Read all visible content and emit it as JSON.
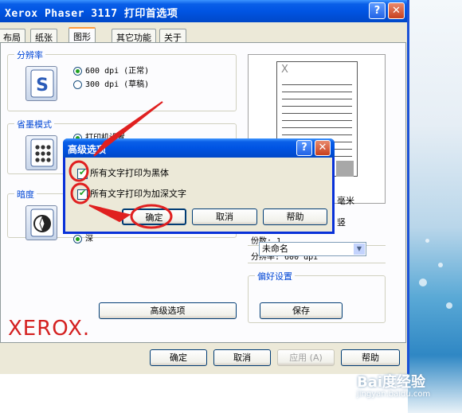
{
  "window": {
    "title": "Xerox Phaser 3117 打印首选项",
    "help_btn": "?",
    "close_btn": "✕"
  },
  "tabs": [
    {
      "label": "布局"
    },
    {
      "label": "纸张"
    },
    {
      "label": "图形"
    },
    {
      "label": "其它功能"
    },
    {
      "label": "关于"
    }
  ],
  "resolution": {
    "label": "分辨率",
    "options": [
      "600 dpi (正常)",
      "300 dpi (草稿)"
    ],
    "selected": 0
  },
  "toner_save": {
    "label": "省墨模式",
    "partial_option": "打印机设置"
  },
  "darkness": {
    "label": "暗度",
    "partial_option": "深"
  },
  "advanced_button": "高级选项",
  "preview": {
    "page_letter": "X",
    "unit_fragment": "毫米",
    "orientation_fragment": "竖",
    "copies": "份数: 1",
    "resolution": "分辨率: 600 dpi"
  },
  "favorites": {
    "label": "偏好设置",
    "selected": "未命名",
    "save_button": "保存"
  },
  "brand": "XEROX.",
  "bottom_buttons": {
    "ok": "确定",
    "cancel": "取消",
    "apply": "应用 (A)",
    "help": "帮助"
  },
  "dialog": {
    "title": "高级选项",
    "checkboxes": [
      {
        "label": "所有文字打印为黑体",
        "checked": true
      },
      {
        "label": "所有文字打印为加深文字",
        "checked": true
      }
    ],
    "ok": "确定",
    "cancel": "取消",
    "help": "帮助"
  },
  "watermark": {
    "text": "Bai度经验",
    "sub": "jingyan.baidu.com"
  },
  "colors": {
    "title_blue": "#0054e3",
    "annotation_red": "#e02020",
    "xerox_red": "#d42020",
    "group_label_blue": "#0046d5"
  }
}
